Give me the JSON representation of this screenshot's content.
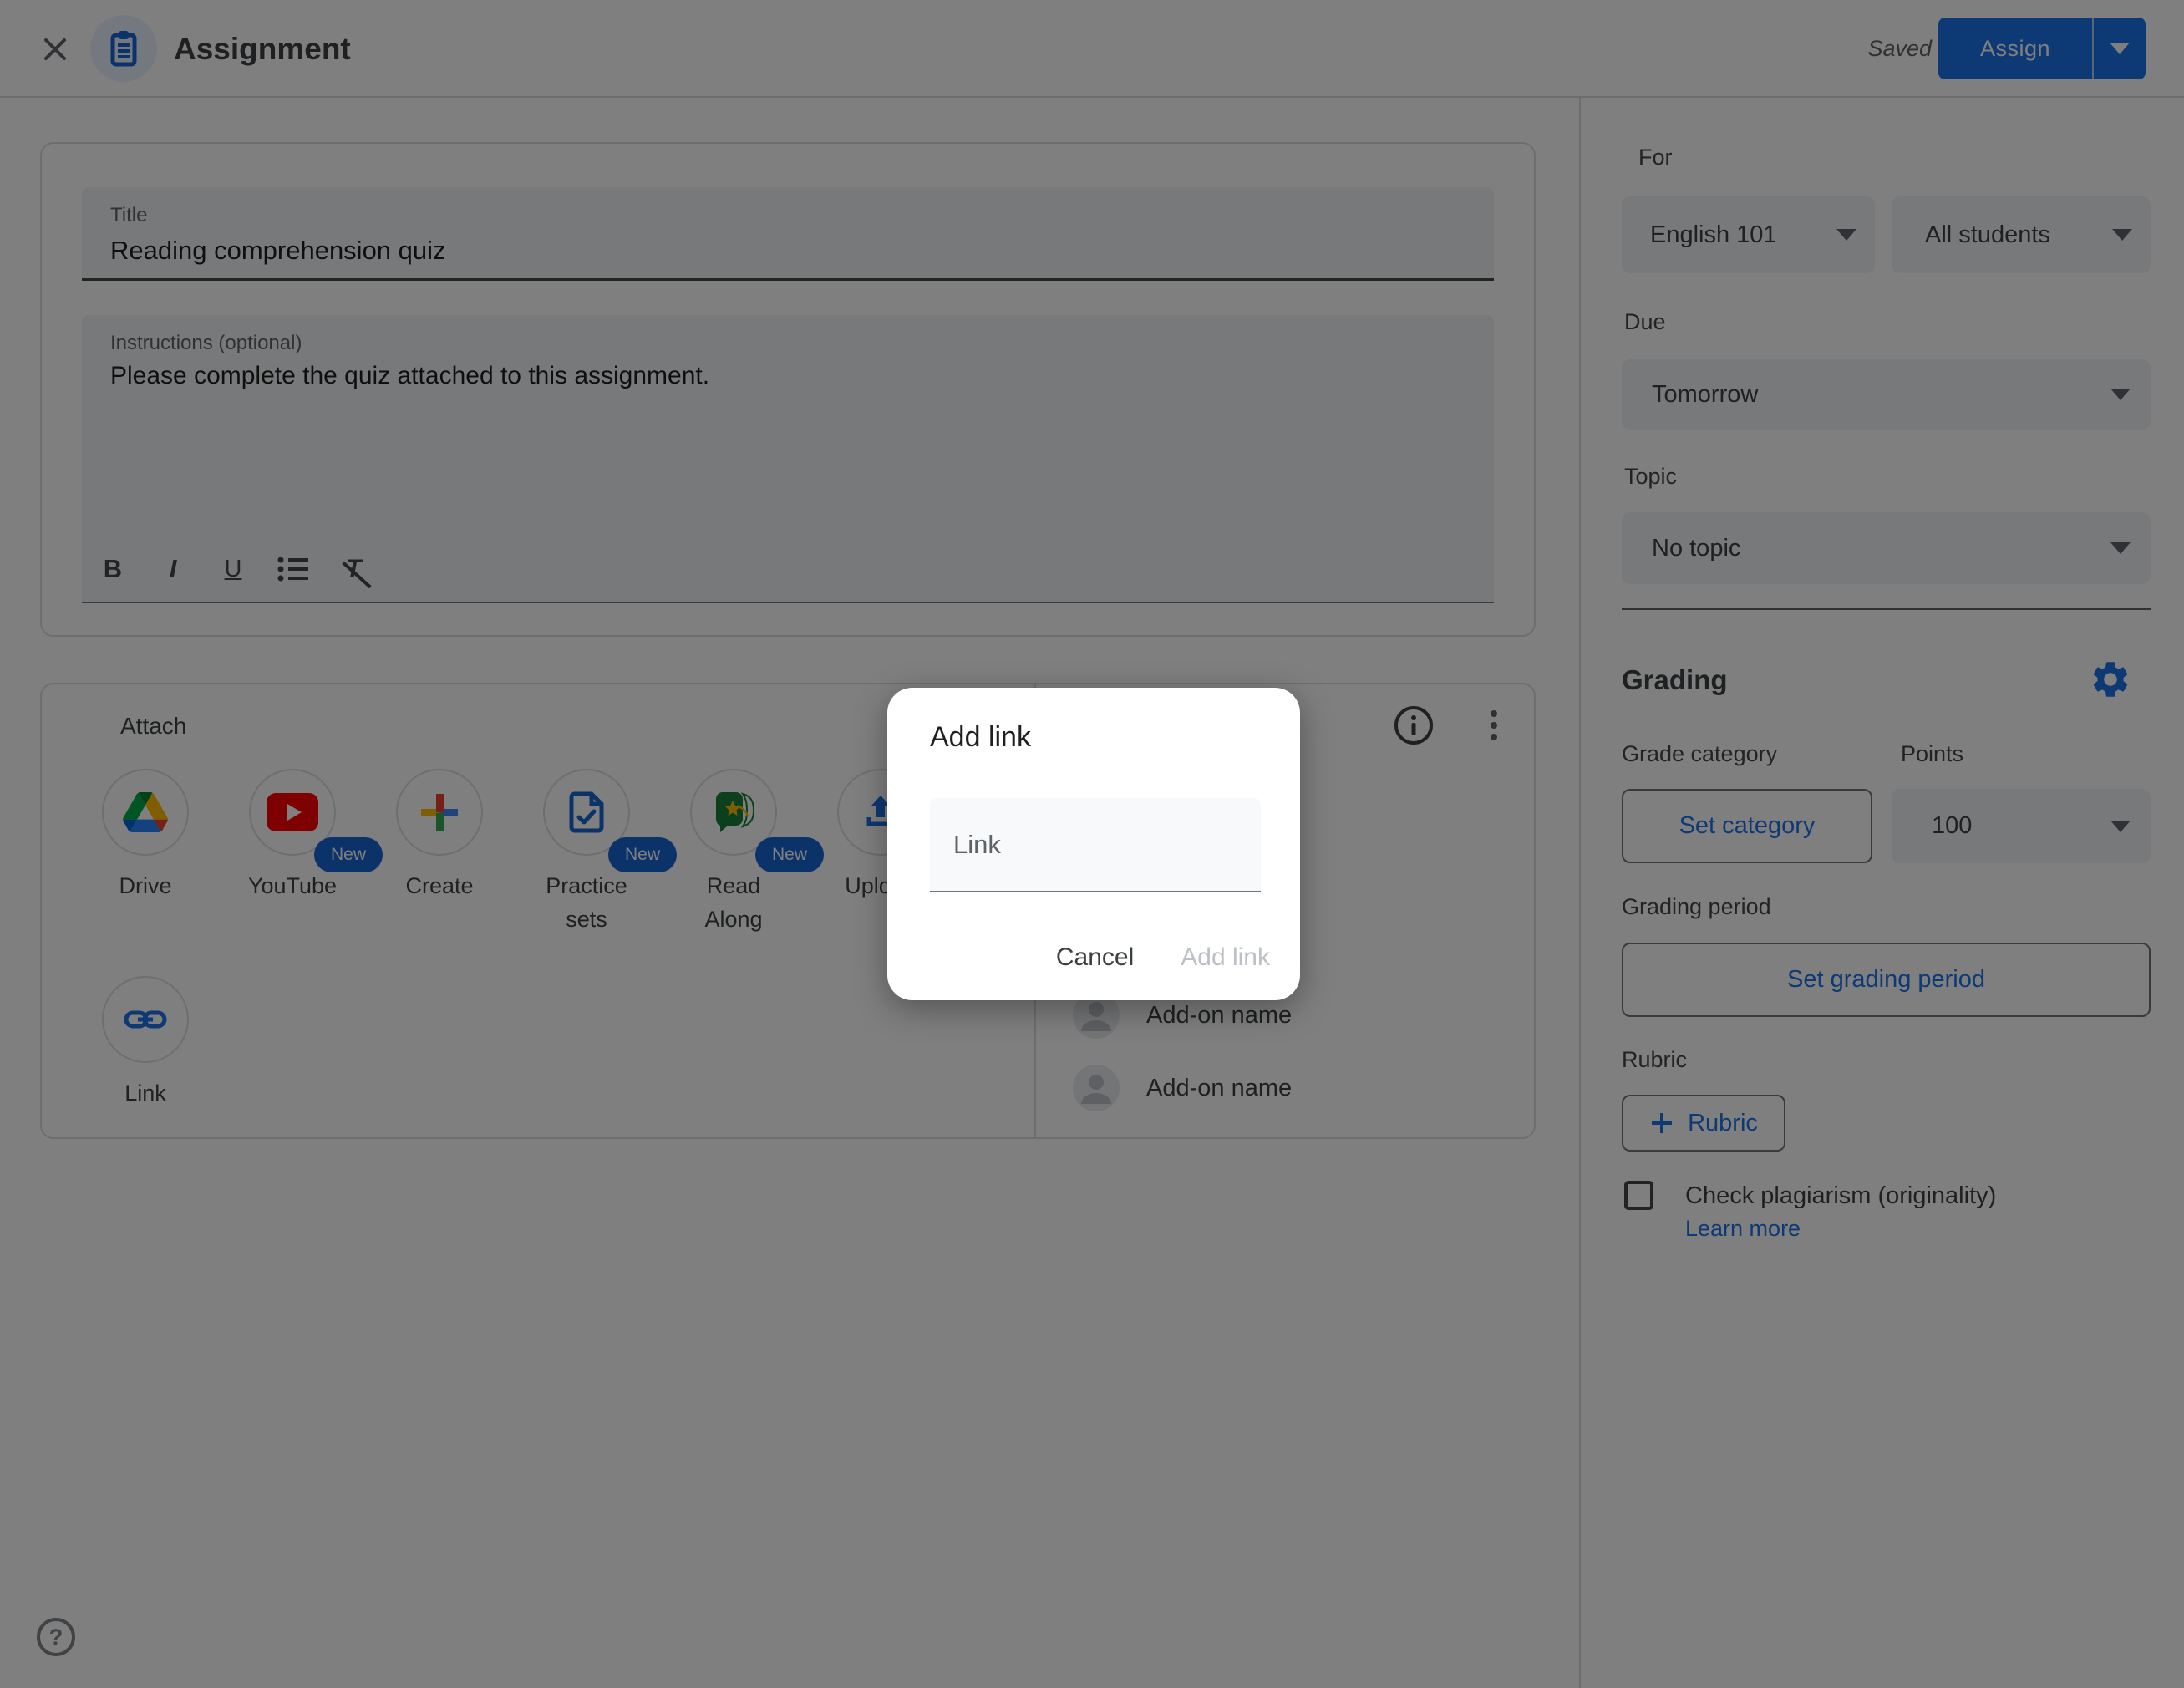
{
  "topbar": {
    "title": "Assignment",
    "saved": "Saved",
    "assign": "Assign"
  },
  "form": {
    "title_label": "Title",
    "title_value": "Reading comprehension quiz",
    "instructions_label": "Instructions (optional)",
    "instructions_value": "Please complete the quiz attached to this assignment.",
    "toolbar": {
      "bold": "B",
      "italic": "I",
      "underline": "U"
    }
  },
  "attach": {
    "header": "Attach",
    "options": [
      {
        "label": "Drive"
      },
      {
        "label": "YouTube",
        "badge": "New"
      },
      {
        "label": "Create"
      },
      {
        "label": "Practice sets",
        "badge": "New"
      },
      {
        "label": "Read Along",
        "badge": "New"
      },
      {
        "label": "Upload"
      },
      {
        "label": "Link"
      }
    ]
  },
  "addons": {
    "items": [
      {
        "name": "Add-on name"
      },
      {
        "name": "Add-on name"
      }
    ]
  },
  "modal": {
    "title": "Add link",
    "placeholder": "Link",
    "cancel": "Cancel",
    "confirm": "Add link"
  },
  "sidebar": {
    "for_label": "For",
    "class_value": "English 101",
    "students_value": "All students",
    "due_label": "Due",
    "due_value": "Tomorrow",
    "topic_label": "Topic",
    "topic_value": "No topic",
    "grading_title": "Grading",
    "grade_category_label": "Grade category",
    "points_label": "Points",
    "set_category": "Set category",
    "points_value": "100",
    "grading_period_label": "Grading period",
    "set_grading_period": "Set grading period",
    "rubric_label": "Rubric",
    "rubric_button": "Rubric",
    "plagiarism_label": "Check plagiarism (originality)",
    "learn_more": "Learn more"
  },
  "help": {
    "label": "?"
  },
  "colors": {
    "accent": "#1a73e8",
    "badge": "#1967d2",
    "scrim": "rgba(0,0,0,0.5)",
    "field_fill": "#f1f3f4"
  }
}
